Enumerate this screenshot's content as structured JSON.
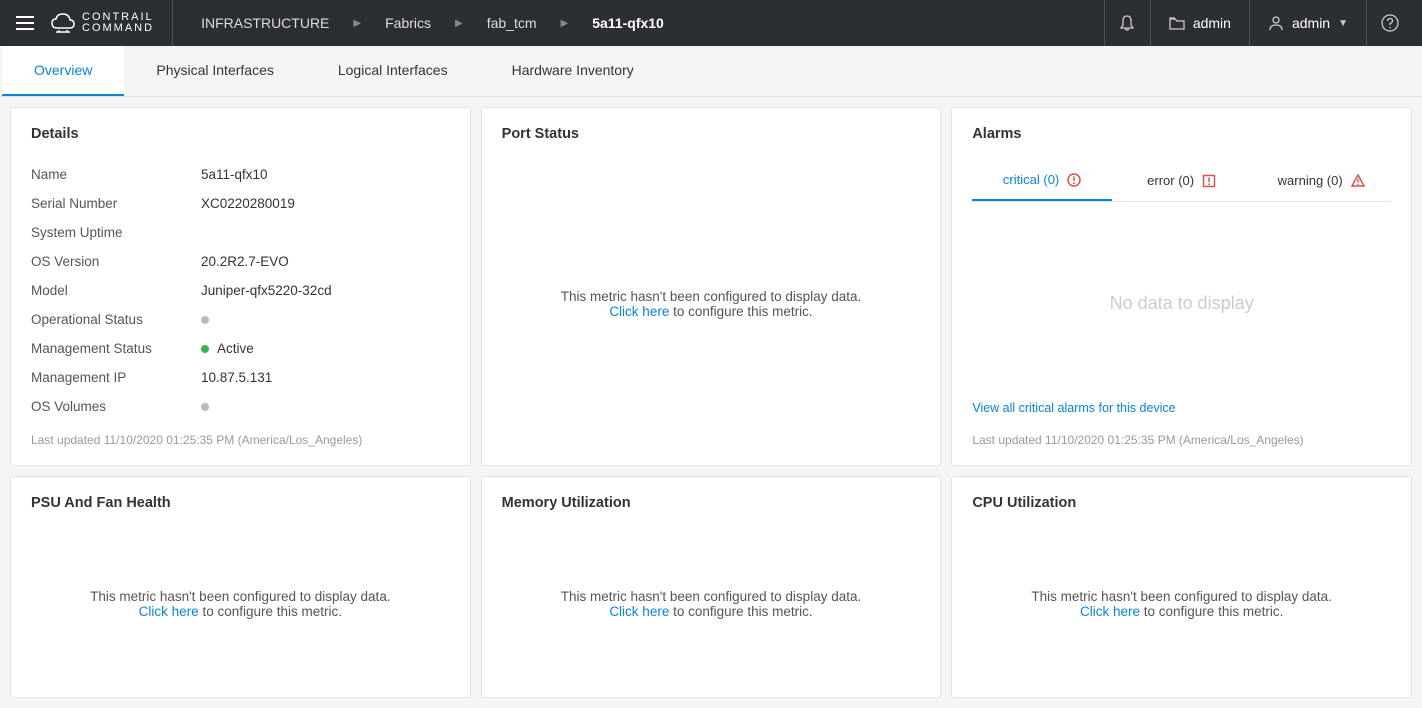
{
  "header": {
    "logo_top": "CONTRAIL",
    "logo_bottom": "COMMAND",
    "breadcrumb": [
      "INFRASTRUCTURE",
      "Fabrics",
      "fab_tcm",
      "5a11-qfx10"
    ],
    "user_tenant": "admin",
    "user_name": "admin"
  },
  "tabs": {
    "items": [
      "Overview",
      "Physical Interfaces",
      "Logical Interfaces",
      "Hardware Inventory"
    ],
    "active": 0
  },
  "details": {
    "title": "Details",
    "rows": [
      {
        "label": "Name",
        "value": "5a11-qfx10"
      },
      {
        "label": "Serial Number",
        "value": "XC0220280019"
      },
      {
        "label": "System Uptime",
        "value": ""
      },
      {
        "label": "OS Version",
        "value": "20.2R2.7-EVO"
      },
      {
        "label": "Model",
        "value": "Juniper-qfx5220-32cd"
      },
      {
        "label": "Operational Status",
        "value": "",
        "dot": "gray"
      },
      {
        "label": "Management Status",
        "value": "Active",
        "dot": "green"
      },
      {
        "label": "Management IP",
        "value": "10.87.5.131"
      },
      {
        "label": "OS Volumes",
        "value": "",
        "dot": "gray"
      }
    ],
    "last_updated": "Last updated 11/10/2020 01:25:35 PM (America/Los_Angeles)"
  },
  "port_status": {
    "title": "Port Status",
    "msg_line1": "This metric hasn't been configured to display data.",
    "click_here": "Click here",
    "msg_line2": " to configure this metric."
  },
  "alarms": {
    "title": "Alarms",
    "tabs": [
      {
        "label": "critical (0)",
        "color": "#d9534f"
      },
      {
        "label": "error (0)",
        "color": "#d9534f"
      },
      {
        "label": "warning (0)",
        "color": "#d9534f"
      }
    ],
    "no_data": "No data to display",
    "view_all": "View all critical alarms for this device",
    "last_updated": "Last updated 11/10/2020 01:25:35 PM (America/Los_Angeles)"
  },
  "psu": {
    "title": "PSU And Fan Health"
  },
  "memory": {
    "title": "Memory Utilization"
  },
  "cpu": {
    "title": "CPU Utilization"
  },
  "metric_empty": {
    "line1": "This metric hasn't been configured to display data.",
    "click": "Click here",
    "line2": " to configure this metric."
  }
}
